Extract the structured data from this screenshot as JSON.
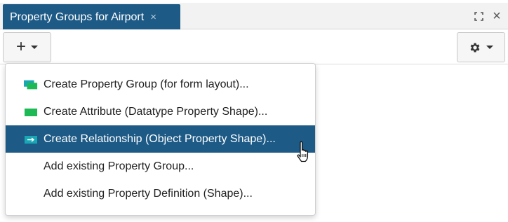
{
  "tab": {
    "title": "Property Groups for Airport",
    "close_icon": "×"
  },
  "window": {
    "maximize_icon": "maximize-icon",
    "close_icon": "×"
  },
  "toolbar": {
    "add_label": "+",
    "settings_icon": "gear-icon"
  },
  "menu": {
    "items": [
      {
        "label": "Create Property Group (for form layout)...",
        "icon": "property-group-icon",
        "active": false
      },
      {
        "label": "Create Attribute (Datatype Property Shape)...",
        "icon": "attribute-icon",
        "active": false
      },
      {
        "label": "Create Relationship (Object Property Shape)...",
        "icon": "relationship-icon",
        "active": true
      },
      {
        "label": "Add existing Property Group...",
        "icon": "",
        "active": false
      },
      {
        "label": "Add existing Property Definition (Shape)...",
        "icon": "",
        "active": false
      }
    ]
  },
  "colors": {
    "accent": "#1d5a86",
    "icon_green": "#1db954",
    "icon_teal": "#18a7b5"
  }
}
